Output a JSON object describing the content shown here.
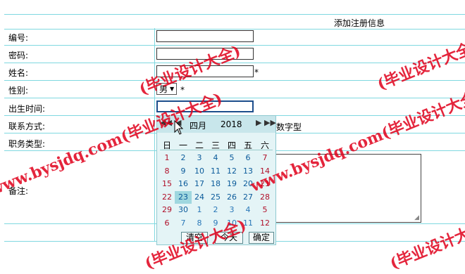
{
  "form": {
    "title": "添加注册信息",
    "fields": [
      {
        "label": "编号:"
      },
      {
        "label": "密码:"
      },
      {
        "label": "姓名:",
        "required_mark": "*"
      },
      {
        "label": "性别:",
        "value": "男",
        "required_mark": "*"
      },
      {
        "label": "出生时间:"
      },
      {
        "label": "联系方式:",
        "hint_fragment": "数字型"
      },
      {
        "label": "职务类型:"
      },
      {
        "label": "备注:"
      }
    ]
  },
  "calendar": {
    "month": "四月",
    "year": "2018",
    "weekdays": [
      "日",
      "一",
      "二",
      "三",
      "四",
      "五",
      "六"
    ],
    "weeks": [
      [
        "1",
        "2",
        "3",
        "4",
        "5",
        "6",
        "7"
      ],
      [
        "8",
        "9",
        "10",
        "11",
        "12",
        "13",
        "14"
      ],
      [
        "15",
        "16",
        "17",
        "18",
        "19",
        "20",
        "21"
      ],
      [
        "22",
        "23",
        "24",
        "25",
        "26",
        "27",
        "28"
      ],
      [
        "29",
        "30",
        "1",
        "2",
        "3",
        "4",
        "5"
      ],
      [
        "6",
        "7",
        "8",
        "9",
        "10",
        "11",
        "12"
      ]
    ],
    "selected_day": "23",
    "buttons": {
      "clear": "清空",
      "today": "今天",
      "ok": "确定"
    },
    "nav_icons": [
      "double-left-arrow-icon",
      "left-arrow-icon",
      "right-arrow-icon",
      "double-right-arrow-icon"
    ]
  },
  "watermark": {
    "text_a": "www.bysjdq.com(毕业设计大全)",
    "text_b": "(毕业设计大全)",
    "color": "#e0001b"
  }
}
